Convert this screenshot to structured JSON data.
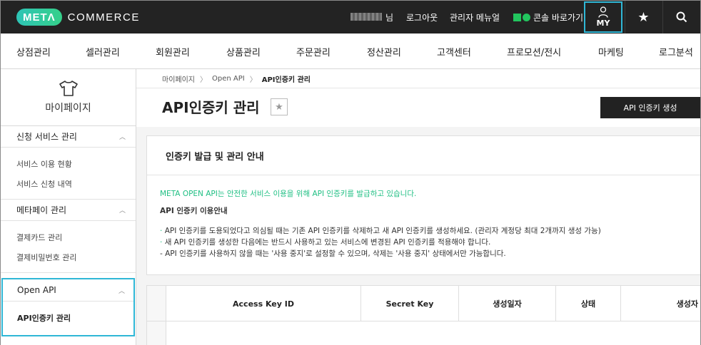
{
  "header": {
    "logo_badge": "METΛ",
    "logo_text": "COMMERCE",
    "user_suffix": "님",
    "logout": "로그아웃",
    "admin_manual": "관리자 메뉴얼",
    "console_shortcut": "콘솔 바로가기",
    "my_label": "MY",
    "icons": {
      "my": "person-icon",
      "favorites": "star-icon",
      "search": "search-icon"
    }
  },
  "gnb": {
    "items": [
      {
        "label": "상점관리"
      },
      {
        "label": "셀러관리"
      },
      {
        "label": "회원관리"
      },
      {
        "label": "상품관리"
      },
      {
        "label": "주문관리"
      },
      {
        "label": "정산관리"
      },
      {
        "label": "고객센터"
      },
      {
        "label": "프로모션/전시"
      },
      {
        "label": "마케팅"
      },
      {
        "label": "로그분석"
      }
    ]
  },
  "sidebar": {
    "title": "마이페이지",
    "icon": "shirt-icon",
    "sections": [
      {
        "label": "신청 서비스 관리",
        "links": [
          "서비스 이용 현황",
          "서비스 신청 내역"
        ]
      },
      {
        "label": "메타페이 관리",
        "links": [
          "결제카드 관리",
          "결제비밀번호 관리"
        ]
      },
      {
        "label": "Open API",
        "links": [
          "API인증키 관리"
        ],
        "active": true
      }
    ]
  },
  "breadcrumb": [
    "마이페이지",
    "Open API",
    "API인증키 관리"
  ],
  "page": {
    "title": "API인증키 관리",
    "generate_button": "API 인증키 생성"
  },
  "info": {
    "heading": "인증키 발급 및 관리 안내",
    "green_notice": "META OPEN API는 안전한 서비스 이용을 위해 API 인증키를 발급하고 있습니다.",
    "subheading": "API 인증키 이용안내",
    "lines": [
      "API 인증키를 도용되었다고 의심될 때는 기존 API 인증키를 삭제하고 새 API 인증키를 생성하세요. (관리자 계정당 최대 2개까지 생성 가능)",
      "새 API 인증키를 생성한 다음에는 반드시 사용하고 있는 서비스에 변경된 API 인증키를 적용해야 합니다.",
      "- API 인증키를 사용하지 않을 때는 '사용 중지'로 설정할 수 있으며, 삭제는 '사용 중지' 상태에서만 가능합니다."
    ]
  },
  "table": {
    "columns": [
      "Access Key ID",
      "Secret Key",
      "생성일자",
      "상태",
      "생성자"
    ]
  },
  "colors": {
    "accent_green": "#1fbf83",
    "highlight_blue": "#2fb7d6",
    "topbar": "#232323"
  }
}
